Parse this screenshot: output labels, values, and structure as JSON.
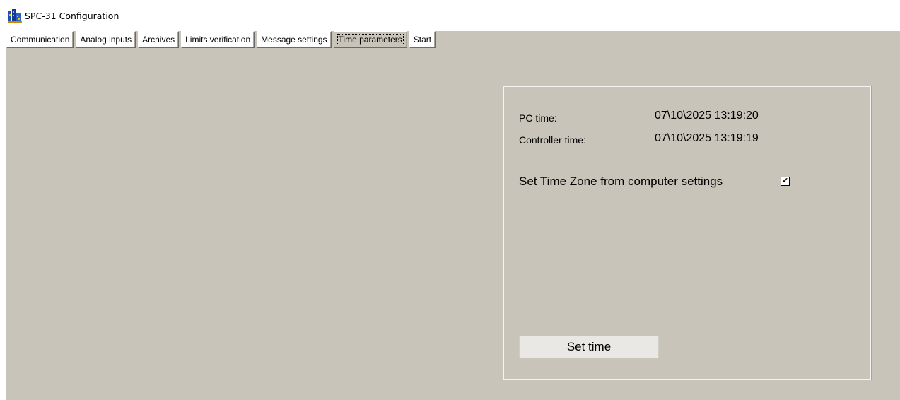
{
  "window": {
    "title": "SPC-31 Configuration",
    "icon": "app-building-icon"
  },
  "tabs": [
    {
      "label": "Communication",
      "active": false
    },
    {
      "label": "Analog inputs",
      "active": false
    },
    {
      "label": "Archives",
      "active": false
    },
    {
      "label": "Limits verification",
      "active": false
    },
    {
      "label": "Message settings",
      "active": false
    },
    {
      "label": "Time parameters",
      "active": true
    },
    {
      "label": "Start",
      "active": false
    }
  ],
  "time_panel": {
    "pc_time_label": "PC time:",
    "pc_time_value": "07\\10\\2025 13:19:20",
    "controller_time_label": "Controller time:",
    "controller_time_value": "07\\10\\2025 13:19:19",
    "timezone_label": "Set Time Zone from computer settings",
    "timezone_checked": true,
    "check_mark": "✔",
    "set_time_button": "Set time"
  },
  "colors": {
    "panel_background": "#c8c4b9",
    "tab_background": "#ffffff"
  }
}
